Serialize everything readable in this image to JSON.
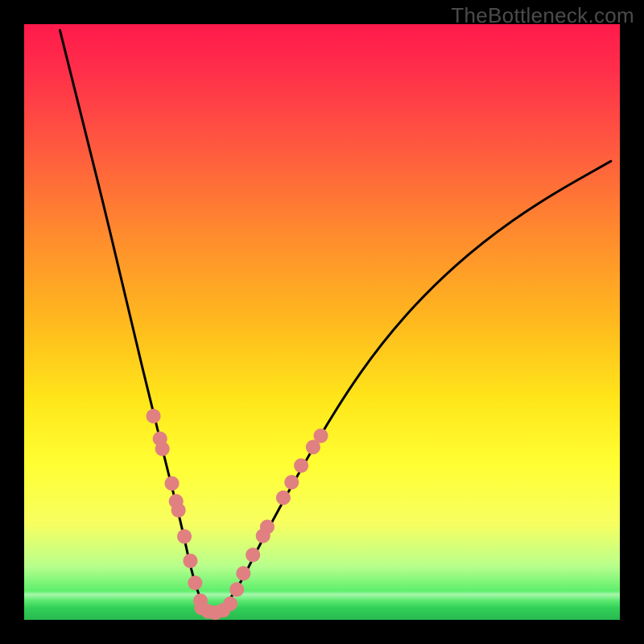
{
  "watermark": "TheBottleneck.com",
  "chart_data": {
    "type": "line",
    "title": "",
    "xlabel": "",
    "ylabel": "",
    "xlim": [
      0,
      1
    ],
    "ylim": [
      0,
      1
    ],
    "background_gradient": {
      "top": "#ff1a4b",
      "mid": "#ffe61a",
      "bottom": "#28b94e",
      "note": "red-green vertical gradient (high=top, low=bottom)"
    },
    "series": [
      {
        "name": "bottleneck-curve",
        "x": [
          0.06,
          0.1,
          0.14,
          0.18,
          0.215,
          0.245,
          0.265,
          0.28,
          0.295,
          0.31,
          0.33,
          0.36,
          0.4,
          0.46,
          0.53,
          0.6,
          0.68,
          0.77,
          0.87,
          0.985
        ],
        "y": [
          0.99,
          0.83,
          0.67,
          0.5,
          0.355,
          0.235,
          0.155,
          0.085,
          0.035,
          0.015,
          0.015,
          0.055,
          0.135,
          0.245,
          0.365,
          0.465,
          0.555,
          0.635,
          0.705,
          0.77
        ]
      }
    ],
    "markers": [
      {
        "name": "left-branch-dots",
        "color": "#e08080",
        "points": [
          {
            "x": 0.217,
            "y": 0.342
          },
          {
            "x": 0.228,
            "y": 0.304
          },
          {
            "x": 0.232,
            "y": 0.287
          },
          {
            "x": 0.248,
            "y": 0.229
          },
          {
            "x": 0.255,
            "y": 0.199
          },
          {
            "x": 0.259,
            "y": 0.184
          },
          {
            "x": 0.269,
            "y": 0.14
          },
          {
            "x": 0.279,
            "y": 0.099
          },
          {
            "x": 0.287,
            "y": 0.062
          },
          {
            "x": 0.296,
            "y": 0.032
          }
        ]
      },
      {
        "name": "right-branch-dots",
        "color": "#e08080",
        "points": [
          {
            "x": 0.357,
            "y": 0.051
          },
          {
            "x": 0.368,
            "y": 0.078
          },
          {
            "x": 0.384,
            "y": 0.109
          },
          {
            "x": 0.401,
            "y": 0.141
          },
          {
            "x": 0.408,
            "y": 0.156
          },
          {
            "x": 0.435,
            "y": 0.205
          },
          {
            "x": 0.449,
            "y": 0.231
          },
          {
            "x": 0.465,
            "y": 0.259
          },
          {
            "x": 0.485,
            "y": 0.29
          },
          {
            "x": 0.498,
            "y": 0.309
          }
        ]
      },
      {
        "name": "bottom-dots",
        "color": "#e08080",
        "points": [
          {
            "x": 0.298,
            "y": 0.02
          },
          {
            "x": 0.309,
            "y": 0.014
          },
          {
            "x": 0.321,
            "y": 0.012
          },
          {
            "x": 0.334,
            "y": 0.016
          },
          {
            "x": 0.346,
            "y": 0.027
          }
        ]
      }
    ]
  }
}
